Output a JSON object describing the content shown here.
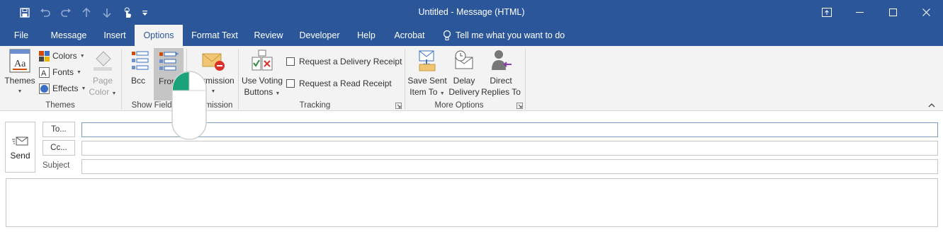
{
  "window": {
    "title": "Untitled  -  Message (HTML)",
    "accent_color": "#2b579a",
    "controls": [
      "ribbon-display-options",
      "minimize",
      "maximize",
      "close"
    ]
  },
  "quick_access": {
    "items": [
      "save-icon",
      "undo-icon",
      "redo-icon",
      "up-arrow-icon",
      "down-arrow-icon",
      "touch-mode-icon",
      "customize-qat-icon"
    ]
  },
  "tabs": [
    {
      "label": "File"
    },
    {
      "label": "Message"
    },
    {
      "label": "Insert"
    },
    {
      "label": "Options",
      "active": true
    },
    {
      "label": "Format Text"
    },
    {
      "label": "Review"
    },
    {
      "label": "Developer"
    },
    {
      "label": "Help"
    },
    {
      "label": "Acrobat"
    }
  ],
  "tell_me": "Tell me what you want to do",
  "ribbon": {
    "themes": {
      "label": "Themes",
      "themes_button": "Themes",
      "colors": "Colors",
      "fonts": "Fonts",
      "effects": "Effects",
      "page_color_line1": "Page",
      "page_color_line2": "Color"
    },
    "show_fields": {
      "label": "Show Fields",
      "bcc": "Bcc",
      "from": "From"
    },
    "permission": {
      "label": "Permission",
      "button": "Permission"
    },
    "tracking": {
      "label": "Tracking",
      "voting_line1": "Use Voting",
      "voting_line2": "Buttons",
      "delivery_receipt": "Request a Delivery Receipt",
      "read_receipt": "Request a Read Receipt"
    },
    "more_options": {
      "label": "More Options",
      "save_sent_line1": "Save Sent",
      "save_sent_line2": "Item To",
      "delay_line1": "Delay",
      "delay_line2": "Delivery",
      "direct_line1": "Direct",
      "direct_line2": "Replies To"
    }
  },
  "compose": {
    "send": "Send",
    "to_button": "To...",
    "cc_button": "Cc...",
    "subject_label": "Subject",
    "to_value": "",
    "cc_value": "",
    "subject_value": "",
    "body_value": ""
  }
}
